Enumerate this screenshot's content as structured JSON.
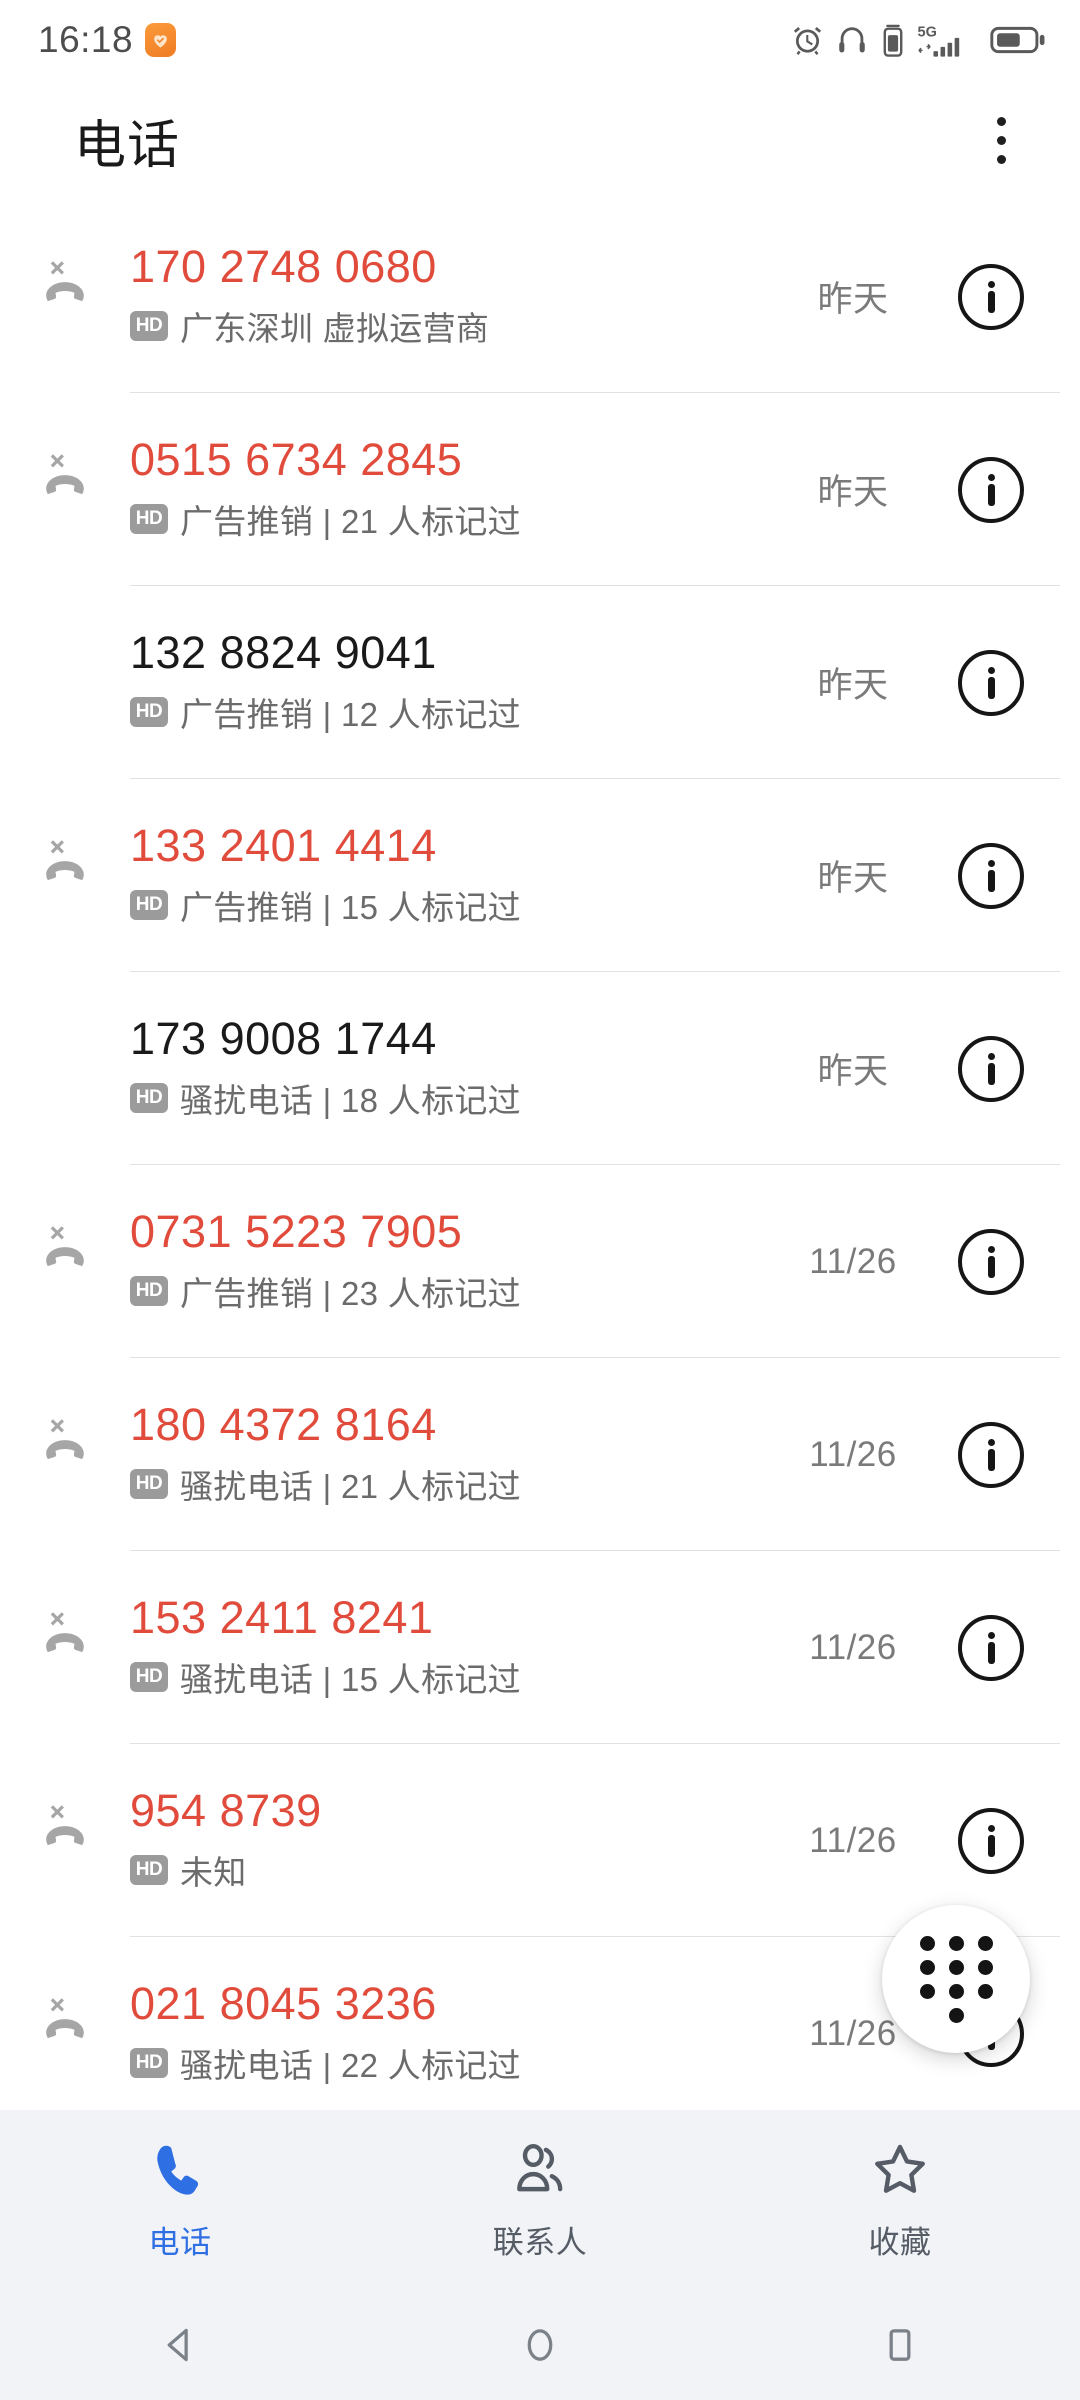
{
  "statusbar": {
    "time": "16:18",
    "app_icon": "heart-shield-icon",
    "icons": [
      "alarm-icon",
      "headphones-icon",
      "vibrate-icon",
      "signal-5g-icon",
      "battery-icon"
    ],
    "network": "5G"
  },
  "appbar": {
    "title": "电话",
    "overflow_label": "more-options"
  },
  "calls": [
    {
      "number": "170 2748 0680",
      "missed": true,
      "hd": "HD",
      "label": "广东深圳 虚拟运营商",
      "date": "昨天"
    },
    {
      "number": "0515 6734 2845",
      "missed": true,
      "hd": "HD",
      "label": "广告推销 | 21 人标记过",
      "date": "昨天"
    },
    {
      "number": "132 8824 9041",
      "missed": false,
      "hd": "HD",
      "label": "广告推销 | 12 人标记过",
      "date": "昨天"
    },
    {
      "number": "133 2401 4414",
      "missed": true,
      "hd": "HD",
      "label": "广告推销 | 15 人标记过",
      "date": "昨天"
    },
    {
      "number": "173 9008 1744",
      "missed": false,
      "hd": "HD",
      "label": "骚扰电话 | 18 人标记过",
      "date": "昨天"
    },
    {
      "number": "0731 5223 7905",
      "missed": true,
      "hd": "HD",
      "label": "广告推销 | 23 人标记过",
      "date": "11/26"
    },
    {
      "number": "180 4372 8164",
      "missed": true,
      "hd": "HD",
      "label": "骚扰电话 | 21 人标记过",
      "date": "11/26"
    },
    {
      "number": "153 2411 8241",
      "missed": true,
      "hd": "HD",
      "label": "骚扰电话 | 15 人标记过",
      "date": "11/26"
    },
    {
      "number": "954 8739",
      "missed": true,
      "hd": "HD",
      "label": "未知",
      "date": "11/26"
    },
    {
      "number": "021 8045 3236",
      "missed": true,
      "hd": "HD",
      "label": "骚扰电话 | 22 人标记过",
      "date": "11/26"
    }
  ],
  "fab": {
    "icon": "dialpad-icon",
    "label": "拨号键盘"
  },
  "tabs": [
    {
      "label": "电话",
      "icon": "phone-icon",
      "active": true
    },
    {
      "label": "联系人",
      "icon": "contacts-icon",
      "active": false
    },
    {
      "label": "收藏",
      "icon": "star-icon",
      "active": false
    }
  ],
  "sysnav": [
    {
      "icon": "back-icon"
    },
    {
      "icon": "home-icon"
    },
    {
      "icon": "recents-icon"
    }
  ],
  "colors": {
    "missed_red": "#e14b3c",
    "accent_blue": "#2f6fe4",
    "tabbar_bg": "#f1f3f7",
    "hd_badge": "#9b9b9b",
    "divider": "#e2e2e2"
  }
}
